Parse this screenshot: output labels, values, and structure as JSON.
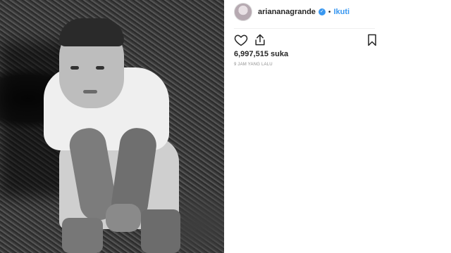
{
  "post": {
    "username": "ariananagrande",
    "follow_label": "Ikuti",
    "separator": "•",
    "likes_text": "6,997,515 suka",
    "timestamp": "9 JAM YANG LALU"
  },
  "icons": {
    "like": "heart-icon",
    "share": "share-icon",
    "save": "bookmark-icon",
    "verified": "verified-badge-icon"
  },
  "colors": {
    "accent": "#3897f0",
    "text": "#262626",
    "muted": "#8e8e8e"
  }
}
